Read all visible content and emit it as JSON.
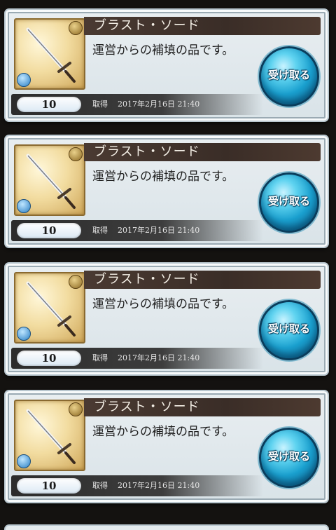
{
  "items": [
    {
      "name": "ブラスト・ソード",
      "description": "運営からの補填の品です。",
      "count": "10",
      "date_label": "取得",
      "date": "2017年2月16日 21:40",
      "action_label": "受け取る",
      "icon": "sword-icon"
    },
    {
      "name": "ブラスト・ソード",
      "description": "運営からの補填の品です。",
      "count": "10",
      "date_label": "取得",
      "date": "2017年2月16日 21:40",
      "action_label": "受け取る",
      "icon": "sword-icon"
    },
    {
      "name": "ブラスト・ソード",
      "description": "運営からの補填の品です。",
      "count": "10",
      "date_label": "取得",
      "date": "2017年2月16日 21:40",
      "action_label": "受け取る",
      "icon": "sword-icon"
    },
    {
      "name": "ブラスト・ソード",
      "description": "運営からの補填の品です。",
      "count": "10",
      "date_label": "取得",
      "date": "2017年2月16日 21:40",
      "action_label": "受け取る",
      "icon": "sword-icon"
    }
  ],
  "colors": {
    "name_bar": "#3a2d27",
    "button": "#1aa0cf",
    "card_bg": "#e4ebee"
  }
}
